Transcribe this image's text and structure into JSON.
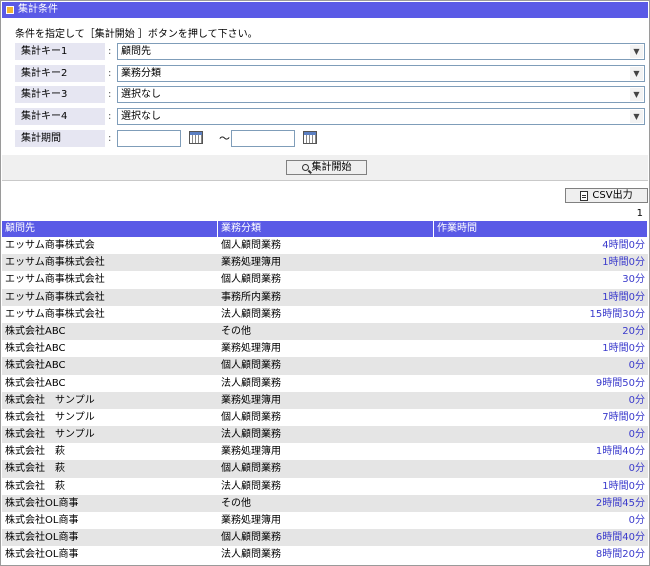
{
  "panel": {
    "title": "集計条件"
  },
  "instruction": "条件を指定して［集計開始 ］ボタンを押して下さい。",
  "keys": [
    {
      "label": "集計キー1",
      "value": "顧問先"
    },
    {
      "label": "集計キー2",
      "value": "業務分類"
    },
    {
      "label": "集計キー3",
      "value": "選択なし"
    },
    {
      "label": "集計キー4",
      "value": "選択なし"
    }
  ],
  "colon": ":",
  "period": {
    "label": "集計期間",
    "from": "",
    "to": "",
    "separator": "～"
  },
  "buttons": {
    "search": "集計開始",
    "csv": "CSV出力"
  },
  "page_number": "1",
  "table": {
    "headers": [
      "顧問先",
      "業務分類",
      "作業時間"
    ],
    "rows": [
      [
        "エッサム商事株式会",
        "個人顧問業務",
        "4時間0分"
      ],
      [
        "エッサム商事株式会社",
        "業務処理簿用",
        "1時間0分"
      ],
      [
        "エッサム商事株式会社",
        "個人顧問業務",
        "30分"
      ],
      [
        "エッサム商事株式会社",
        "事務所内業務",
        "1時間0分"
      ],
      [
        "エッサム商事株式会社",
        "法人顧問業務",
        "15時間30分"
      ],
      [
        "株式会社ABC",
        "その他",
        "20分"
      ],
      [
        "株式会社ABC",
        "業務処理簿用",
        "1時間0分"
      ],
      [
        "株式会社ABC",
        "個人顧問業務",
        "0分"
      ],
      [
        "株式会社ABC",
        "法人顧問業務",
        "9時間50分"
      ],
      [
        "株式会社　サンプル",
        "業務処理簿用",
        "0分"
      ],
      [
        "株式会社　サンプル",
        "個人顧問業務",
        "7時間0分"
      ],
      [
        "株式会社　サンプル",
        "法人顧問業務",
        "0分"
      ],
      [
        "株式会社　萩",
        "業務処理簿用",
        "1時間40分"
      ],
      [
        "株式会社　萩",
        "個人顧問業務",
        "0分"
      ],
      [
        "株式会社　萩",
        "法人顧問業務",
        "1時間0分"
      ],
      [
        "株式会社OL商事",
        "その他",
        "2時間45分"
      ],
      [
        "株式会社OL商事",
        "業務処理簿用",
        "0分"
      ],
      [
        "株式会社OL商事",
        "個人顧問業務",
        "6時間40分"
      ],
      [
        "株式会社OL商事",
        "法人顧問業務",
        "8時間20分"
      ]
    ]
  },
  "icons": {
    "header": "orange-square-icon",
    "calendar": "calendar-icon",
    "search": "magnifier-icon",
    "csv": "document-icon",
    "dropdown": "chevron-down-icon"
  },
  "colors": {
    "header_bg": "#5a5ae6",
    "label_bg": "#e6e6f2",
    "time_text": "#3a3acc",
    "stripe": "#e5e5e5"
  }
}
